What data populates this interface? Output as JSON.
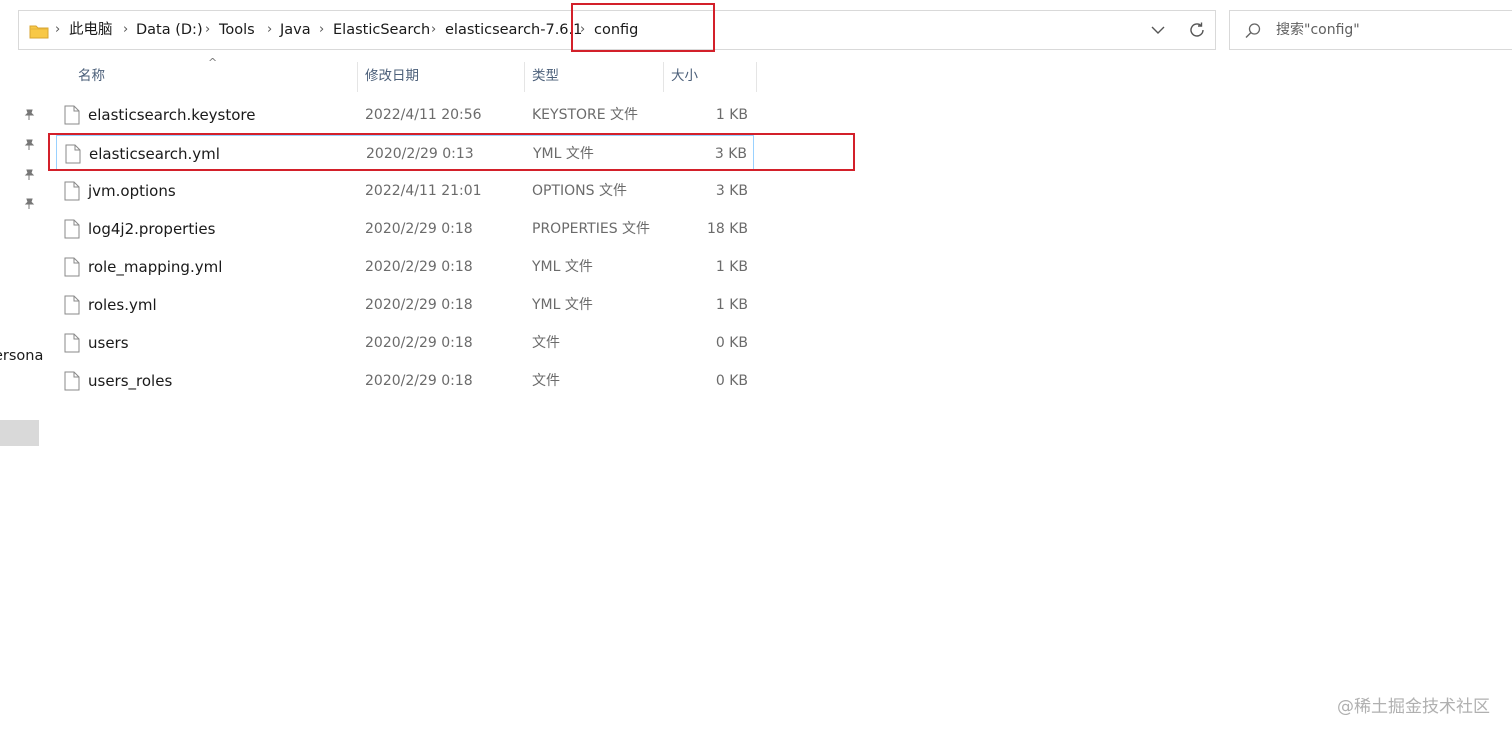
{
  "address": {
    "breadcrumbs": [
      "此电脑",
      "Data (D:)",
      "Tools",
      "Java",
      "ElasticSearch",
      "elasticsearch-7.6.1",
      "config"
    ],
    "separator": "›"
  },
  "search": {
    "placeholder": "搜索\"config\""
  },
  "nav": {
    "partial_label": "ersona"
  },
  "columns": {
    "name": "名称",
    "date": "修改日期",
    "type": "类型",
    "size": "大小",
    "sort_indicator": "^"
  },
  "files": [
    {
      "name": "elasticsearch.keystore",
      "date": "2022/4/11 20:56",
      "type": "KEYSTORE 文件",
      "size": "1 KB"
    },
    {
      "name": "elasticsearch.yml",
      "date": "2020/2/29 0:13",
      "type": "YML 文件",
      "size": "3 KB"
    },
    {
      "name": "jvm.options",
      "date": "2022/4/11 21:01",
      "type": "OPTIONS 文件",
      "size": "3 KB"
    },
    {
      "name": "log4j2.properties",
      "date": "2020/2/29 0:18",
      "type": "PROPERTIES 文件",
      "size": "18 KB"
    },
    {
      "name": "role_mapping.yml",
      "date": "2020/2/29 0:18",
      "type": "YML 文件",
      "size": "1 KB"
    },
    {
      "name": "roles.yml",
      "date": "2020/2/29 0:18",
      "type": "YML 文件",
      "size": "1 KB"
    },
    {
      "name": "users",
      "date": "2020/2/29 0:18",
      "type": "文件",
      "size": "0 KB"
    },
    {
      "name": "users_roles",
      "date": "2020/2/29 0:18",
      "type": "文件",
      "size": "0 KB"
    }
  ],
  "watermark": "@稀土掘金技术社区",
  "colors": {
    "highlight": "#d3202a",
    "selection_border": "#99d1ff",
    "folder": "#f8c846"
  }
}
